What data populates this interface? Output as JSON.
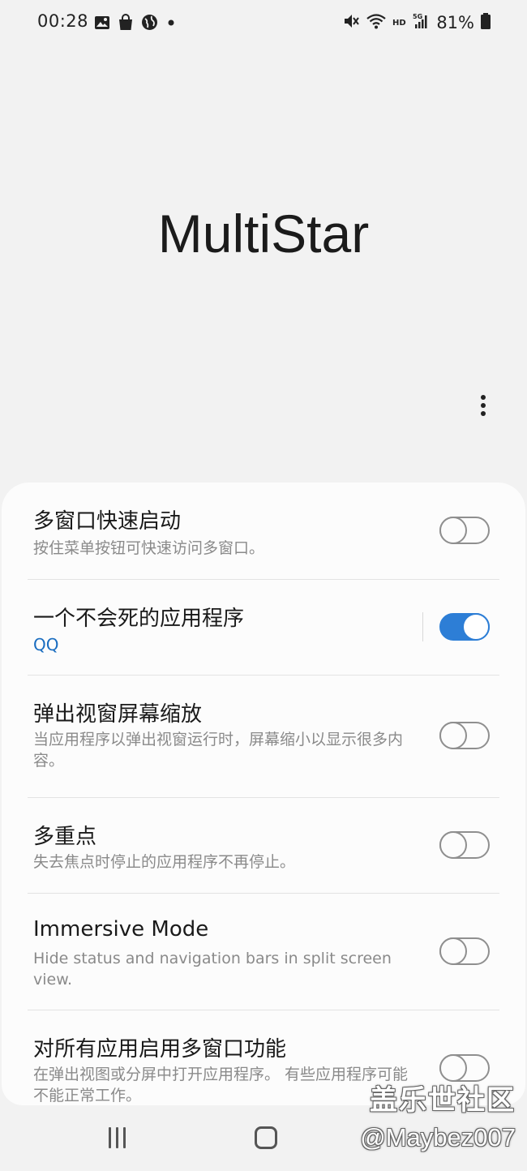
{
  "status_bar": {
    "time": "00:28",
    "left_icons": [
      "image-icon",
      "shopping-bag-icon",
      "globe-icon",
      "dot-icon"
    ],
    "right_icons": [
      "mute-vibrate-icon",
      "wifi-icon",
      "hd-icon",
      "5g-signal-icon",
      "battery-icon"
    ],
    "battery": "81%"
  },
  "app": {
    "title": "MultiStar"
  },
  "settings": [
    {
      "title": "多窗口快速启动",
      "subtitle": "按住菜单按钮可快速访问多窗口。",
      "enabled": false
    },
    {
      "title": "一个不会死的应用程序",
      "subtitle": "QQ",
      "enabled": true
    },
    {
      "title": "弹出视窗屏幕缩放",
      "subtitle": "当应用程序以弹出视窗运行时，屏幕缩小以显示很多内容。",
      "enabled": false
    },
    {
      "title": "多重点",
      "subtitle": "失去焦点时停止的应用程序不再停止。",
      "enabled": false
    },
    {
      "title": "Immersive Mode",
      "subtitle": "Hide status and navigation bars in split screen view.",
      "enabled": false
    },
    {
      "title": "对所有应用启用多窗口功能",
      "subtitle": "在弹出视图或分屏中打开应用程序。 有些应用程序可能不能正常工作。",
      "enabled": false
    }
  ],
  "watermark": {
    "line1": "盖乐世社区",
    "line2": "@Maybez007"
  },
  "colors": {
    "accent": "#2d7ed6",
    "background": "#f2f2f2",
    "card": "#fcfcfc"
  }
}
